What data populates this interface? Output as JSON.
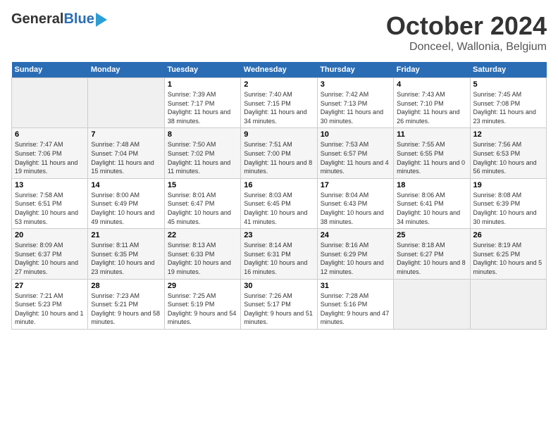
{
  "header": {
    "logo_general": "General",
    "logo_blue": "Blue",
    "title": "October 2024",
    "location": "Donceel, Wallonia, Belgium"
  },
  "days_of_week": [
    "Sunday",
    "Monday",
    "Tuesday",
    "Wednesday",
    "Thursday",
    "Friday",
    "Saturday"
  ],
  "weeks": [
    [
      {
        "day": "",
        "info": ""
      },
      {
        "day": "",
        "info": ""
      },
      {
        "day": "1",
        "info": "Sunrise: 7:39 AM\nSunset: 7:17 PM\nDaylight: 11 hours and 38 minutes."
      },
      {
        "day": "2",
        "info": "Sunrise: 7:40 AM\nSunset: 7:15 PM\nDaylight: 11 hours and 34 minutes."
      },
      {
        "day": "3",
        "info": "Sunrise: 7:42 AM\nSunset: 7:13 PM\nDaylight: 11 hours and 30 minutes."
      },
      {
        "day": "4",
        "info": "Sunrise: 7:43 AM\nSunset: 7:10 PM\nDaylight: 11 hours and 26 minutes."
      },
      {
        "day": "5",
        "info": "Sunrise: 7:45 AM\nSunset: 7:08 PM\nDaylight: 11 hours and 23 minutes."
      }
    ],
    [
      {
        "day": "6",
        "info": "Sunrise: 7:47 AM\nSunset: 7:06 PM\nDaylight: 11 hours and 19 minutes."
      },
      {
        "day": "7",
        "info": "Sunrise: 7:48 AM\nSunset: 7:04 PM\nDaylight: 11 hours and 15 minutes."
      },
      {
        "day": "8",
        "info": "Sunrise: 7:50 AM\nSunset: 7:02 PM\nDaylight: 11 hours and 11 minutes."
      },
      {
        "day": "9",
        "info": "Sunrise: 7:51 AM\nSunset: 7:00 PM\nDaylight: 11 hours and 8 minutes."
      },
      {
        "day": "10",
        "info": "Sunrise: 7:53 AM\nSunset: 6:57 PM\nDaylight: 11 hours and 4 minutes."
      },
      {
        "day": "11",
        "info": "Sunrise: 7:55 AM\nSunset: 6:55 PM\nDaylight: 11 hours and 0 minutes."
      },
      {
        "day": "12",
        "info": "Sunrise: 7:56 AM\nSunset: 6:53 PM\nDaylight: 10 hours and 56 minutes."
      }
    ],
    [
      {
        "day": "13",
        "info": "Sunrise: 7:58 AM\nSunset: 6:51 PM\nDaylight: 10 hours and 53 minutes."
      },
      {
        "day": "14",
        "info": "Sunrise: 8:00 AM\nSunset: 6:49 PM\nDaylight: 10 hours and 49 minutes."
      },
      {
        "day": "15",
        "info": "Sunrise: 8:01 AM\nSunset: 6:47 PM\nDaylight: 10 hours and 45 minutes."
      },
      {
        "day": "16",
        "info": "Sunrise: 8:03 AM\nSunset: 6:45 PM\nDaylight: 10 hours and 41 minutes."
      },
      {
        "day": "17",
        "info": "Sunrise: 8:04 AM\nSunset: 6:43 PM\nDaylight: 10 hours and 38 minutes."
      },
      {
        "day": "18",
        "info": "Sunrise: 8:06 AM\nSunset: 6:41 PM\nDaylight: 10 hours and 34 minutes."
      },
      {
        "day": "19",
        "info": "Sunrise: 8:08 AM\nSunset: 6:39 PM\nDaylight: 10 hours and 30 minutes."
      }
    ],
    [
      {
        "day": "20",
        "info": "Sunrise: 8:09 AM\nSunset: 6:37 PM\nDaylight: 10 hours and 27 minutes."
      },
      {
        "day": "21",
        "info": "Sunrise: 8:11 AM\nSunset: 6:35 PM\nDaylight: 10 hours and 23 minutes."
      },
      {
        "day": "22",
        "info": "Sunrise: 8:13 AM\nSunset: 6:33 PM\nDaylight: 10 hours and 19 minutes."
      },
      {
        "day": "23",
        "info": "Sunrise: 8:14 AM\nSunset: 6:31 PM\nDaylight: 10 hours and 16 minutes."
      },
      {
        "day": "24",
        "info": "Sunrise: 8:16 AM\nSunset: 6:29 PM\nDaylight: 10 hours and 12 minutes."
      },
      {
        "day": "25",
        "info": "Sunrise: 8:18 AM\nSunset: 6:27 PM\nDaylight: 10 hours and 8 minutes."
      },
      {
        "day": "26",
        "info": "Sunrise: 8:19 AM\nSunset: 6:25 PM\nDaylight: 10 hours and 5 minutes."
      }
    ],
    [
      {
        "day": "27",
        "info": "Sunrise: 7:21 AM\nSunset: 5:23 PM\nDaylight: 10 hours and 1 minute."
      },
      {
        "day": "28",
        "info": "Sunrise: 7:23 AM\nSunset: 5:21 PM\nDaylight: 9 hours and 58 minutes."
      },
      {
        "day": "29",
        "info": "Sunrise: 7:25 AM\nSunset: 5:19 PM\nDaylight: 9 hours and 54 minutes."
      },
      {
        "day": "30",
        "info": "Sunrise: 7:26 AM\nSunset: 5:17 PM\nDaylight: 9 hours and 51 minutes."
      },
      {
        "day": "31",
        "info": "Sunrise: 7:28 AM\nSunset: 5:16 PM\nDaylight: 9 hours and 47 minutes."
      },
      {
        "day": "",
        "info": ""
      },
      {
        "day": "",
        "info": ""
      }
    ]
  ]
}
